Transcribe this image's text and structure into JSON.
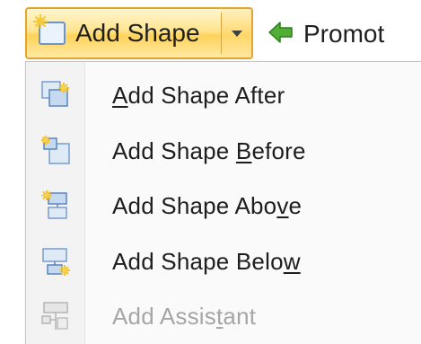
{
  "ribbon": {
    "add_shape_button": {
      "label": "Add Shape",
      "icon": "add-shape-icon",
      "dropdown_icon": "chevron-down-icon"
    },
    "promote_button": {
      "label": "Promot",
      "icon": "green-left-arrow-icon"
    }
  },
  "menu": {
    "items": [
      {
        "pre": "",
        "key": "A",
        "post": "dd Shape After",
        "icon": "add-shape-after-icon",
        "enabled": true
      },
      {
        "pre": "Add Shape ",
        "key": "B",
        "post": "efore",
        "icon": "add-shape-before-icon",
        "enabled": true
      },
      {
        "pre": "Add Shape Abo",
        "key": "v",
        "post": "e",
        "icon": "add-shape-above-icon",
        "enabled": true
      },
      {
        "pre": "Add Shape Belo",
        "key": "w",
        "post": "",
        "icon": "add-shape-below-icon",
        "enabled": true
      },
      {
        "pre": "Add Assis",
        "key": "t",
        "post": "ant",
        "icon": "add-assistant-icon",
        "enabled": false
      }
    ]
  },
  "colors": {
    "button_border": "#e3a52e",
    "button_fill": "#ffd35a",
    "menu_background": "#fafafa",
    "text": "#1e1e1e",
    "disabled_text": "#a6a6a6",
    "promote_arrow": "#3c9a2a"
  }
}
